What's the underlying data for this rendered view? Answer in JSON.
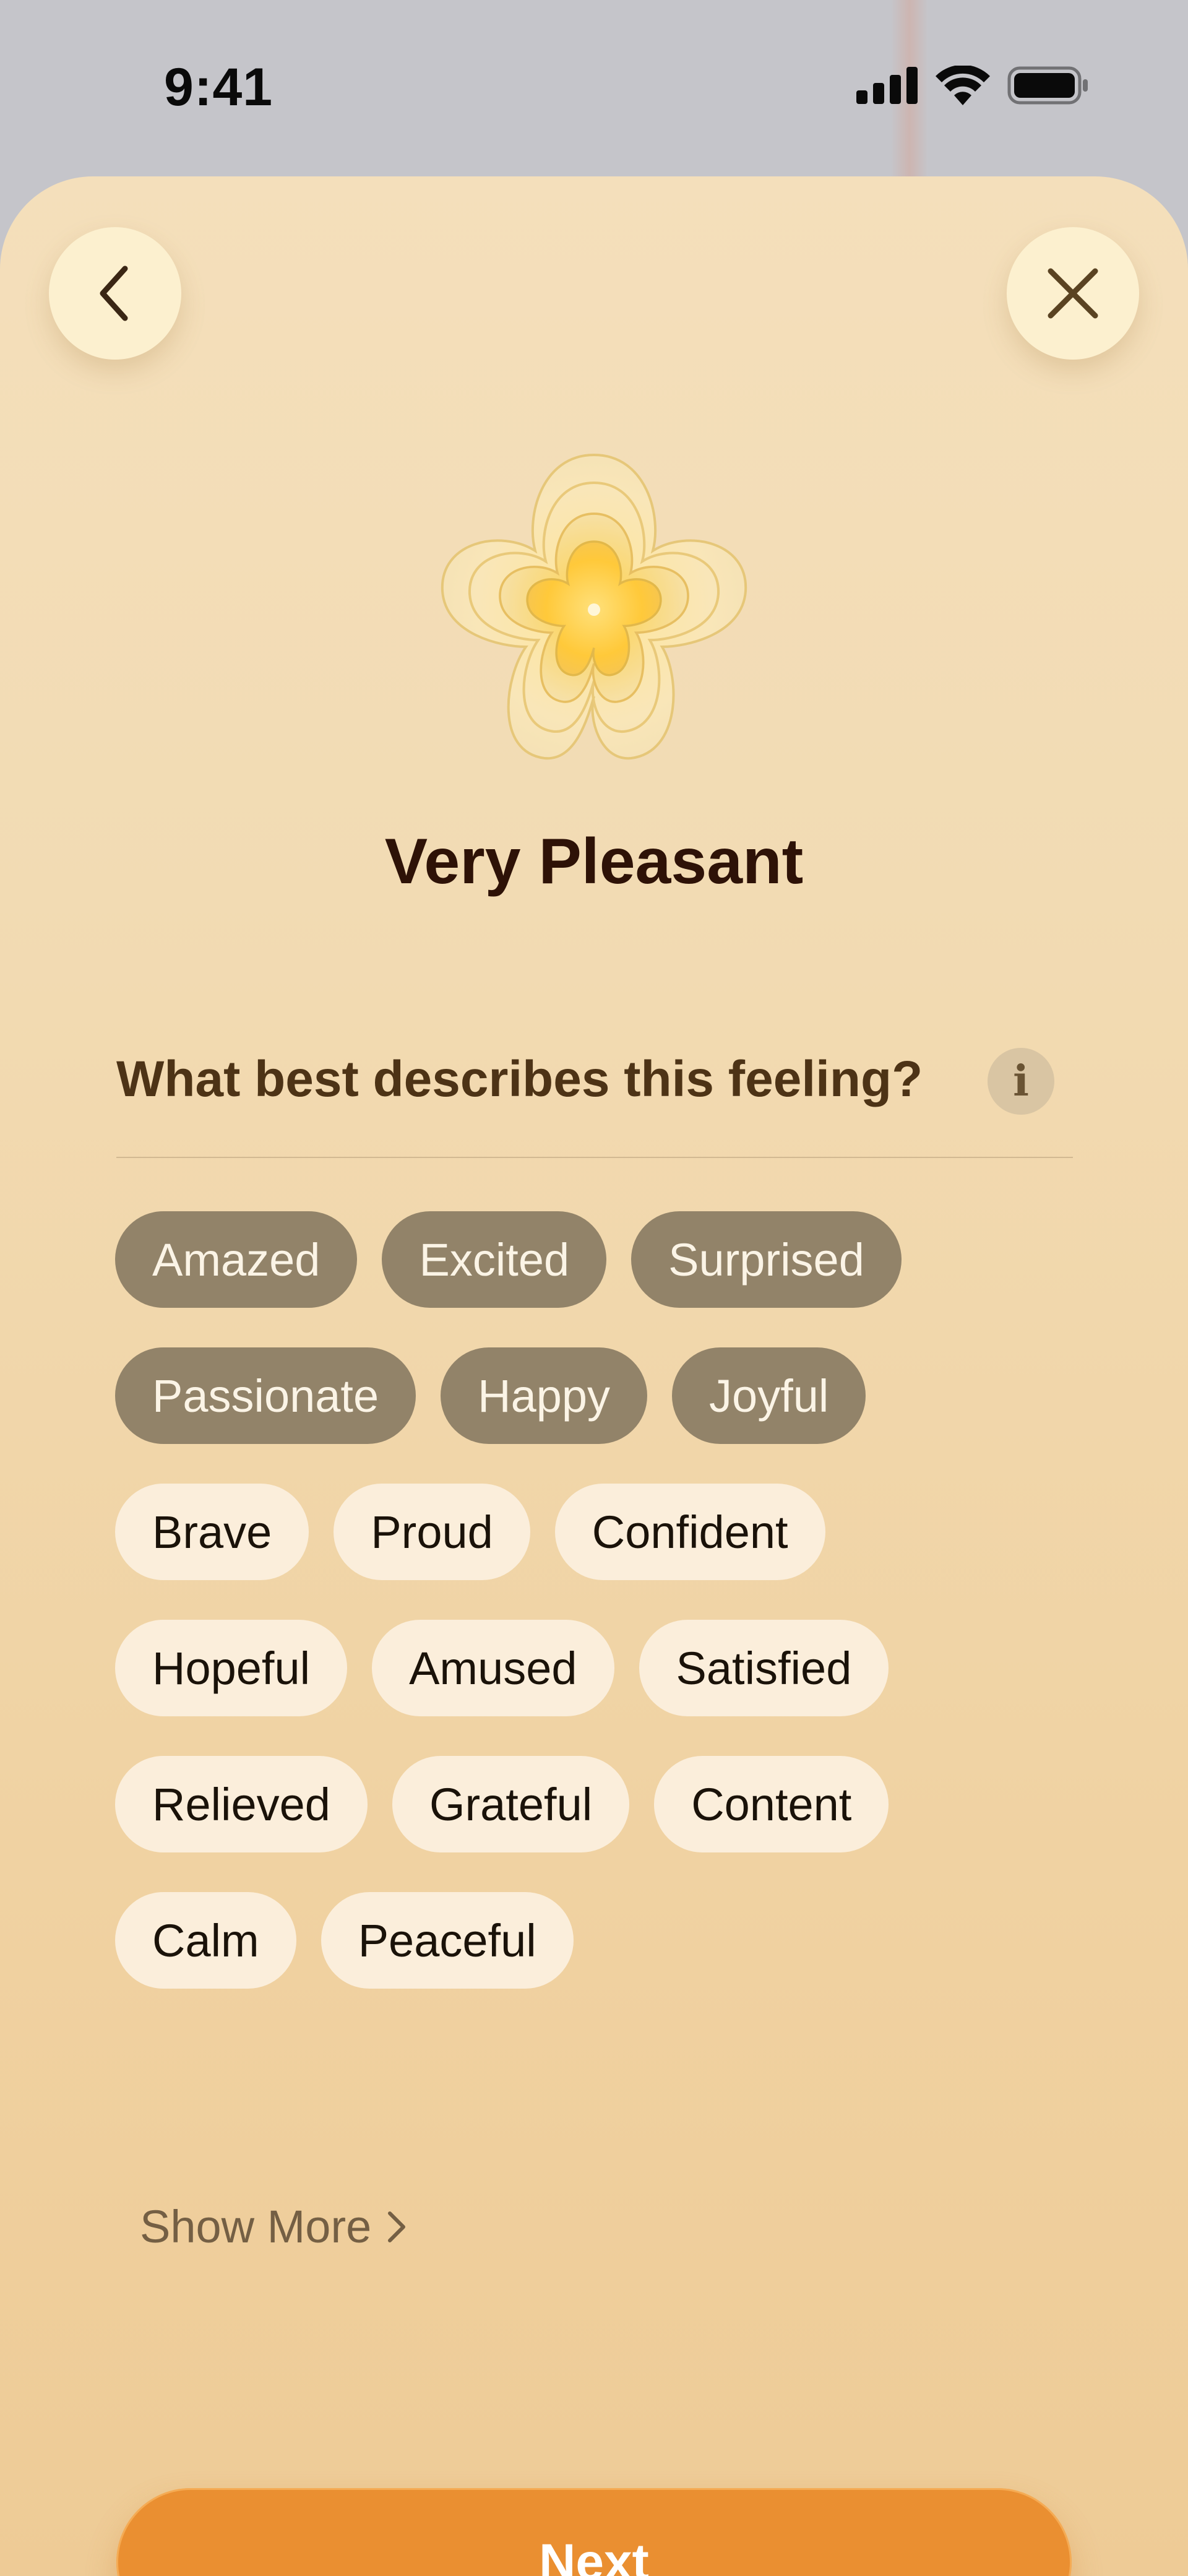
{
  "status_bar": {
    "time": "9:41"
  },
  "mood": {
    "title": "Very Pleasant"
  },
  "question": {
    "text": "What best describes this feeling?",
    "info_glyph": "i"
  },
  "chips": {
    "rows": [
      [
        {
          "label": "Amazed",
          "selected": true
        },
        {
          "label": "Excited",
          "selected": true
        },
        {
          "label": "Surprised",
          "selected": true
        }
      ],
      [
        {
          "label": "Passionate",
          "selected": true
        },
        {
          "label": "Happy",
          "selected": true
        },
        {
          "label": "Joyful",
          "selected": true
        }
      ],
      [
        {
          "label": "Brave",
          "selected": false
        },
        {
          "label": "Proud",
          "selected": false
        },
        {
          "label": "Confident",
          "selected": false
        }
      ],
      [
        {
          "label": "Hopeful",
          "selected": false
        },
        {
          "label": "Amused",
          "selected": false
        },
        {
          "label": "Satisfied",
          "selected": false
        }
      ],
      [
        {
          "label": "Relieved",
          "selected": false
        },
        {
          "label": "Grateful",
          "selected": false
        },
        {
          "label": "Content",
          "selected": false
        }
      ],
      [
        {
          "label": "Calm",
          "selected": false
        },
        {
          "label": "Peaceful",
          "selected": false
        }
      ]
    ]
  },
  "show_more": {
    "label": "Show More"
  },
  "next_button": {
    "label": "Next"
  },
  "colors": {
    "selected_chip": "#928369",
    "unselected_chip": "#fbeedb",
    "accent": "#ea8f31",
    "title": "#2e1207"
  },
  "icons": {
    "back": "chevron-left-icon",
    "close": "close-icon",
    "info": "info-icon",
    "show_more": "chevron-right-icon",
    "mood": "flower-icon"
  }
}
